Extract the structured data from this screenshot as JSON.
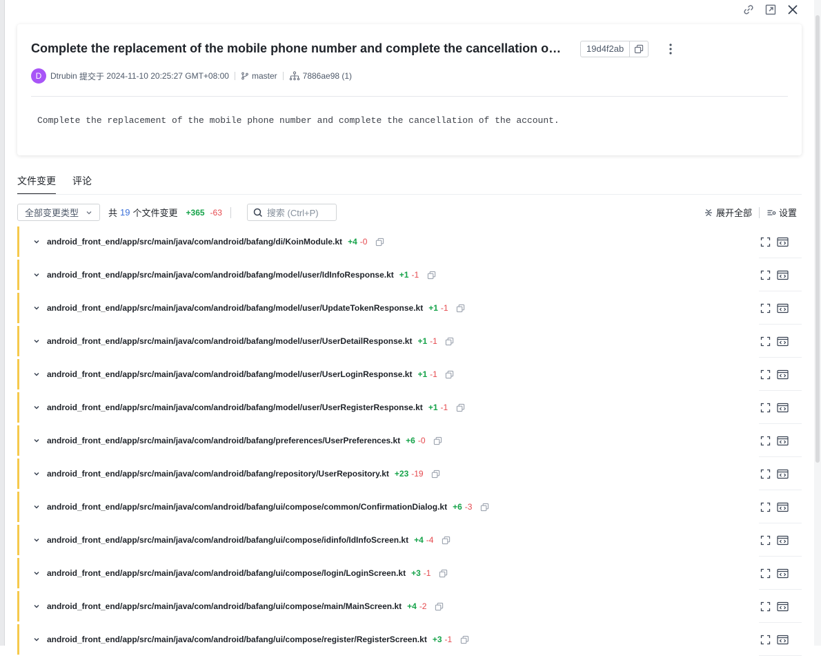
{
  "header_icons": [
    "link-icon",
    "open-external-icon",
    "close-icon"
  ],
  "commit": {
    "title": "Complete the replacement of the mobile phone number and complete the cancellation o…",
    "hash": "19d4f2ab",
    "author_initial": "D",
    "author": "Dtrubin",
    "submitted_label": "提交于",
    "datetime": "2024-11-10 20:25:27 GMT+08:00",
    "branch": "master",
    "parent": "7886ae98 (1)",
    "message": "Complete the replacement of the mobile phone number and complete the cancellation of the account.",
    "colors": {
      "avatar": "#a855f7"
    }
  },
  "tabs": [
    {
      "label": "文件变更",
      "active": true
    },
    {
      "label": "评论",
      "active": false
    }
  ],
  "toolbar": {
    "type_filter": "全部变更类型",
    "summary_prefix": "共",
    "file_count": "19",
    "summary_suffix": "个文件变更",
    "additions": "+365",
    "deletions": "-63",
    "search_placeholder": "搜索 (Ctrl+P)",
    "expand_all": "展开全部",
    "settings": "设置"
  },
  "files": [
    {
      "path": "android_front_end/app/src/main/java/com/android/bafang/di/KoinModule.kt",
      "add": "+4",
      "del": "-0"
    },
    {
      "path": "android_front_end/app/src/main/java/com/android/bafang/model/user/IdInfoResponse.kt",
      "add": "+1",
      "del": "-1"
    },
    {
      "path": "android_front_end/app/src/main/java/com/android/bafang/model/user/UpdateTokenResponse.kt",
      "add": "+1",
      "del": "-1"
    },
    {
      "path": "android_front_end/app/src/main/java/com/android/bafang/model/user/UserDetailResponse.kt",
      "add": "+1",
      "del": "-1"
    },
    {
      "path": "android_front_end/app/src/main/java/com/android/bafang/model/user/UserLoginResponse.kt",
      "add": "+1",
      "del": "-1"
    },
    {
      "path": "android_front_end/app/src/main/java/com/android/bafang/model/user/UserRegisterResponse.kt",
      "add": "+1",
      "del": "-1"
    },
    {
      "path": "android_front_end/app/src/main/java/com/android/bafang/preferences/UserPreferences.kt",
      "add": "+6",
      "del": "-0"
    },
    {
      "path": "android_front_end/app/src/main/java/com/android/bafang/repository/UserRepository.kt",
      "add": "+23",
      "del": "-19"
    },
    {
      "path": "android_front_end/app/src/main/java/com/android/bafang/ui/compose/common/ConfirmationDialog.kt",
      "add": "+6",
      "del": "-3"
    },
    {
      "path": "android_front_end/app/src/main/java/com/android/bafang/ui/compose/idinfo/IdInfoScreen.kt",
      "add": "+4",
      "del": "-4"
    },
    {
      "path": "android_front_end/app/src/main/java/com/android/bafang/ui/compose/login/LoginScreen.kt",
      "add": "+3",
      "del": "-1"
    },
    {
      "path": "android_front_end/app/src/main/java/com/android/bafang/ui/compose/main/MainScreen.kt",
      "add": "+4",
      "del": "-2"
    },
    {
      "path": "android_front_end/app/src/main/java/com/android/bafang/ui/compose/register/RegisterScreen.kt",
      "add": "+3",
      "del": "-1"
    }
  ],
  "colors": {
    "addition": "#16a34a",
    "deletion": "#e5484d",
    "change_stripe": "#f6c94c",
    "link": "#3b70d9"
  }
}
